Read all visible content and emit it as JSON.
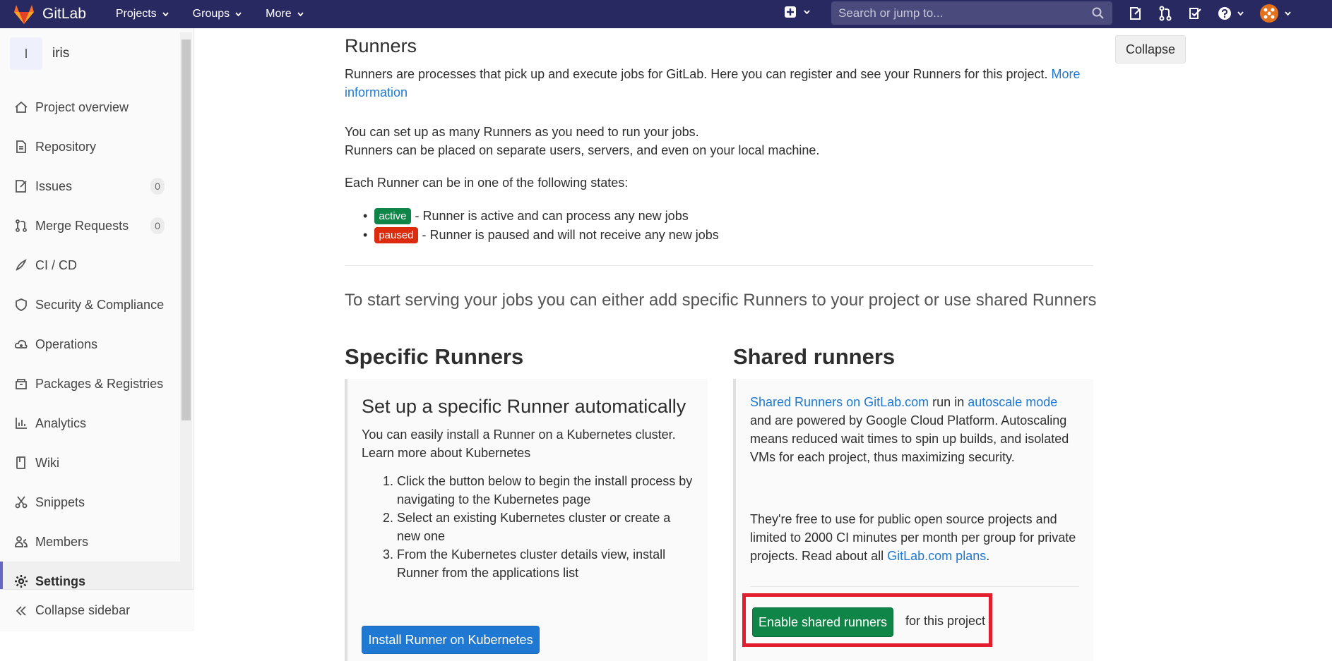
{
  "navbar": {
    "brand": "GitLab",
    "menu": [
      {
        "label": "Projects"
      },
      {
        "label": "Groups"
      },
      {
        "label": "More"
      }
    ],
    "search_placeholder": "Search or jump to..."
  },
  "sidebar": {
    "project_initial": "I",
    "project_name": "iris",
    "items": [
      {
        "label": "Project overview",
        "icon": "home-icon"
      },
      {
        "label": "Repository",
        "icon": "doc-icon"
      },
      {
        "label": "Issues",
        "icon": "issues-icon",
        "count": "0"
      },
      {
        "label": "Merge Requests",
        "icon": "merge-request-icon",
        "count": "0"
      },
      {
        "label": "CI / CD",
        "icon": "rocket-icon"
      },
      {
        "label": "Security & Compliance",
        "icon": "shield-icon"
      },
      {
        "label": "Operations",
        "icon": "cloud-gear-icon"
      },
      {
        "label": "Packages & Registries",
        "icon": "package-icon"
      },
      {
        "label": "Analytics",
        "icon": "chart-icon"
      },
      {
        "label": "Wiki",
        "icon": "book-icon"
      },
      {
        "label": "Snippets",
        "icon": "scissors-icon"
      },
      {
        "label": "Members",
        "icon": "users-icon"
      },
      {
        "label": "Settings",
        "icon": "gear-icon",
        "active": true
      }
    ],
    "collapse_label": "Collapse sidebar"
  },
  "main": {
    "title": "Runners",
    "collapse_button": "Collapse",
    "intro": "Runners are processes that pick up and execute jobs for GitLab. Here you can register and see your Runners for this project.",
    "intro_link_1": "More",
    "intro_link_2": "information",
    "setup_line_1": "You can set up as many Runners as you need to run your jobs.",
    "setup_line_2": "Runners can be placed on separate users, servers, and even on your local machine.",
    "states_intro": "Each Runner can be in one of the following states:",
    "states": [
      {
        "badge": "active",
        "text": "- Runner is active and can process any new jobs",
        "color": "#108548"
      },
      {
        "badge": "paused",
        "text": "- Runner is paused and will not receive any new jobs",
        "color": "#dd2b0e"
      }
    ],
    "lead": "To start serving your jobs you can either add specific Runners to your project or use shared Runners"
  },
  "specific": {
    "title": "Specific Runners",
    "box_title": "Set up a specific Runner automatically",
    "desc": "You can easily install a Runner on a Kubernetes cluster.",
    "learn_more": "Learn more about Kubernetes",
    "steps": [
      "Click the button below to begin the install process by navigating to the Kubernetes page",
      "Select an existing Kubernetes cluster or create a new one",
      "From the Kubernetes cluster details view, install Runner from the applications list"
    ],
    "install_button": "Install Runner on Kubernetes"
  },
  "shared": {
    "title": "Shared runners",
    "p1_link1": "Shared Runners on GitLab.com",
    "p1_text1": "run in",
    "p1_link2": "autoscale mode",
    "p1_text2": "and are powered by Google Cloud Platform. Autoscaling means reduced wait times to spin up builds, and isolated VMs for each project, thus maximizing security.",
    "p2_text": "They're free to use for public open source projects and limited to 2000 CI minutes per month per group for private projects. Read about all",
    "p2_link": "GitLab.com plans",
    "p2_end": ".",
    "enable_button": "Enable shared runners",
    "enable_suffix": "for this project"
  },
  "colors": {
    "navbar": "#292961",
    "link": "#1f78d1",
    "green": "#108548",
    "highlight": "#e21d2d"
  }
}
